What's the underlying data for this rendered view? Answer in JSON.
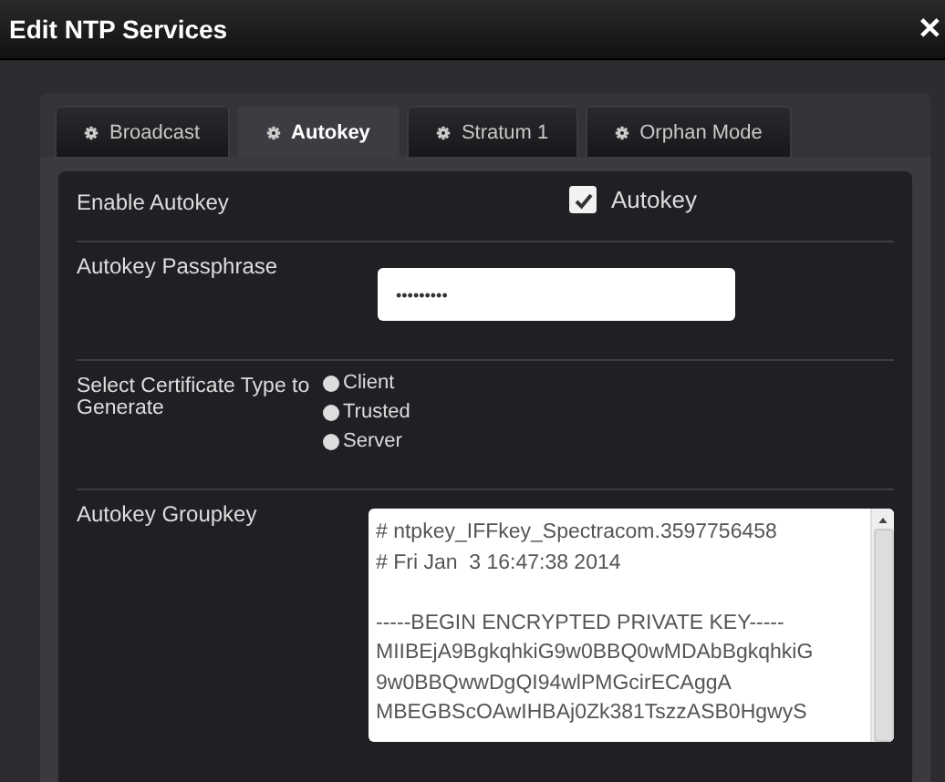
{
  "window": {
    "title": "Edit NTP Services",
    "close": "✕"
  },
  "tabs": [
    {
      "label": "Broadcast",
      "selected": false
    },
    {
      "label": "Autokey",
      "selected": true
    },
    {
      "label": "Stratum 1",
      "selected": false
    },
    {
      "label": "Orphan Mode",
      "selected": false
    }
  ],
  "enable_autokey": {
    "label": "Enable Autokey",
    "checkbox_label": "Autokey",
    "checked": true
  },
  "passphrase": {
    "label": "Autokey Passphrase",
    "value": "•••••••••"
  },
  "certificate_type": {
    "label": "Select Certificate Type to Generate",
    "options": [
      {
        "label": "Client",
        "selected": false
      },
      {
        "label": "Trusted",
        "selected": false
      },
      {
        "label": "Server",
        "selected": false
      }
    ]
  },
  "groupkey": {
    "label": "Autokey Groupkey",
    "header_lines": [
      "# ntpkey_IFFkey_Spectracom.3597756458",
      "# Fri Jan  3 16:47:38 2014"
    ],
    "key_lines": [
      "-----BEGIN ENCRYPTED PRIVATE KEY-----",
      "MIIBEjA9BgkqhkiG9w0BBQ0wMDAbBgkqhkiG",
      "9w0BBQwwDgQI94wlPMGcirECAggA",
      "MBEGBScOAwIHBAj0Zk381TszzASB0HgwyS"
    ]
  }
}
